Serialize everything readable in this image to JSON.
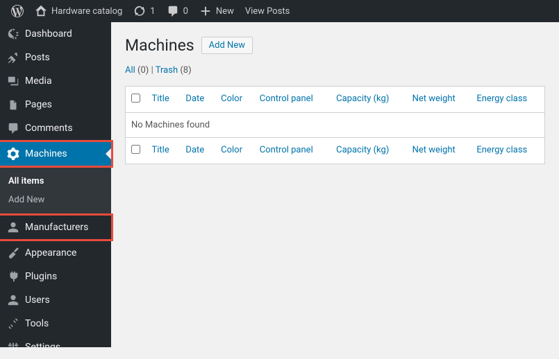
{
  "adminbar": {
    "site_name": "Hardware catalog",
    "updates_count": "1",
    "comments_count": "0",
    "new_label": "New",
    "view_posts_label": "View Posts"
  },
  "sidebar": {
    "dashboard": "Dashboard",
    "posts": "Posts",
    "media": "Media",
    "pages": "Pages",
    "comments": "Comments",
    "machines": "Machines",
    "machines_sub_all": "All items",
    "machines_sub_add": "Add New",
    "manufacturers": "Manufacturers",
    "appearance": "Appearance",
    "plugins": "Plugins",
    "users": "Users",
    "tools": "Tools",
    "settings": "Settings"
  },
  "page": {
    "title": "Machines",
    "add_new": "Add New",
    "filter_all": "All",
    "filter_all_count": "(0)",
    "filter_sep": " | ",
    "filter_trash": "Trash",
    "filter_trash_count": "(8)",
    "no_items": "No Machines found"
  },
  "columns": {
    "title": "Title",
    "date": "Date",
    "color": "Color",
    "control_panel": "Control panel",
    "capacity": "Capacity (kg)",
    "net_weight": "Net weight",
    "energy_class": "Energy class"
  }
}
